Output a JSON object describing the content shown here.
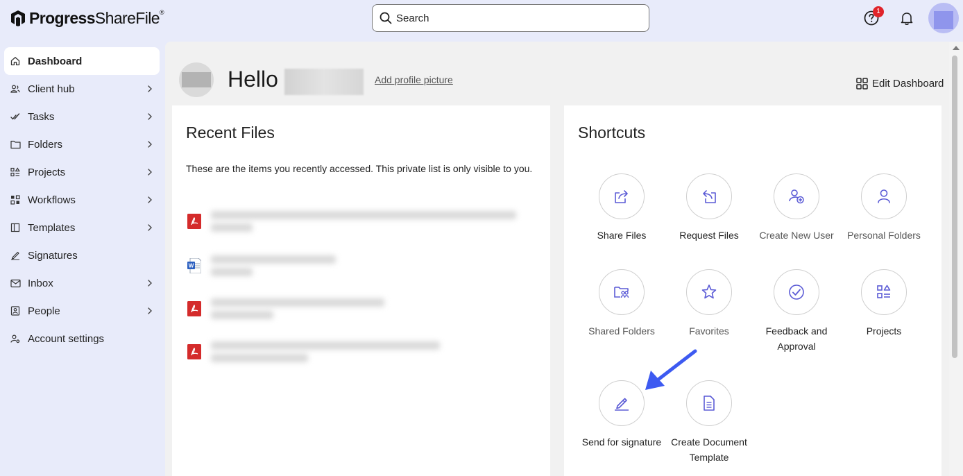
{
  "brand": {
    "name_bold": "Progress",
    "name_regular": "ShareFile",
    "trademark": "®"
  },
  "search": {
    "placeholder": "Search"
  },
  "header": {
    "help_badge_count": "1"
  },
  "sidebar": {
    "items": [
      {
        "label": "Dashboard",
        "icon": "home-icon",
        "has_chevron": false,
        "active": true
      },
      {
        "label": "Client hub",
        "icon": "client-hub-icon",
        "has_chevron": true
      },
      {
        "label": "Tasks",
        "icon": "tasks-check-icon",
        "has_chevron": true
      },
      {
        "label": "Folders",
        "icon": "folder-icon",
        "has_chevron": true
      },
      {
        "label": "Projects",
        "icon": "projects-icon",
        "has_chevron": true
      },
      {
        "label": "Workflows",
        "icon": "workflows-icon",
        "has_chevron": true
      },
      {
        "label": "Templates",
        "icon": "templates-icon",
        "has_chevron": true
      },
      {
        "label": "Signatures",
        "icon": "signature-pen-icon",
        "has_chevron": false
      },
      {
        "label": "Inbox",
        "icon": "inbox-icon",
        "has_chevron": true
      },
      {
        "label": "People",
        "icon": "people-icon",
        "has_chevron": true
      },
      {
        "label": "Account settings",
        "icon": "account-settings-icon",
        "has_chevron": false
      }
    ]
  },
  "main": {
    "greeting": "Hello",
    "add_profile_picture": "Add profile picture",
    "edit_dashboard": "Edit Dashboard",
    "recent_files": {
      "title": "Recent Files",
      "description": "These are the items you recently accessed. This private list is only visible to you.",
      "files": [
        {
          "type": "pdf"
        },
        {
          "type": "word"
        },
        {
          "type": "pdf"
        },
        {
          "type": "pdf"
        }
      ]
    },
    "shortcuts": {
      "title": "Shortcuts",
      "items": [
        {
          "label": "Share Files",
          "icon": "share-files-icon",
          "muted": false
        },
        {
          "label": "Request Files",
          "icon": "request-files-icon",
          "muted": false
        },
        {
          "label": "Create New User",
          "icon": "create-user-icon",
          "muted": true
        },
        {
          "label": "Personal Folders",
          "icon": "personal-folders-icon",
          "muted": true
        },
        {
          "label": "Shared Folders",
          "icon": "shared-folders-icon",
          "muted": true
        },
        {
          "label": "Favorites",
          "icon": "star-icon",
          "muted": true
        },
        {
          "label": "Feedback and Approval",
          "icon": "approval-check-icon",
          "muted": false
        },
        {
          "label": "Projects",
          "icon": "projects-icon",
          "muted": false
        },
        {
          "label": "Send for signature",
          "icon": "signature-pen-icon",
          "muted": false
        },
        {
          "label": "Create Document Template",
          "icon": "document-template-icon",
          "muted": false
        }
      ]
    }
  },
  "colors": {
    "accent": "#5b5bd6",
    "callout_arrow": "#3d5af1",
    "pdf_red": "#d42b2b",
    "word_blue": "#2b5fc0",
    "background": "#e8ebfa"
  }
}
